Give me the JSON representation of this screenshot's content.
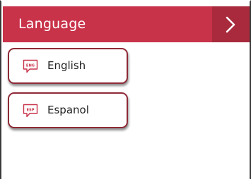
{
  "header": {
    "title": "Language",
    "next_icon": "chevron-right-icon",
    "background": "#c8334a",
    "button_background": "#a82a3c"
  },
  "languages": [
    {
      "code": "ENG",
      "label": "English",
      "icon": "speech-bubble-icon"
    },
    {
      "code": "ESP",
      "label": "Espanol",
      "icon": "speech-bubble-icon"
    }
  ],
  "colors": {
    "accent": "#c8334a",
    "button_border": "#8e2a36"
  }
}
